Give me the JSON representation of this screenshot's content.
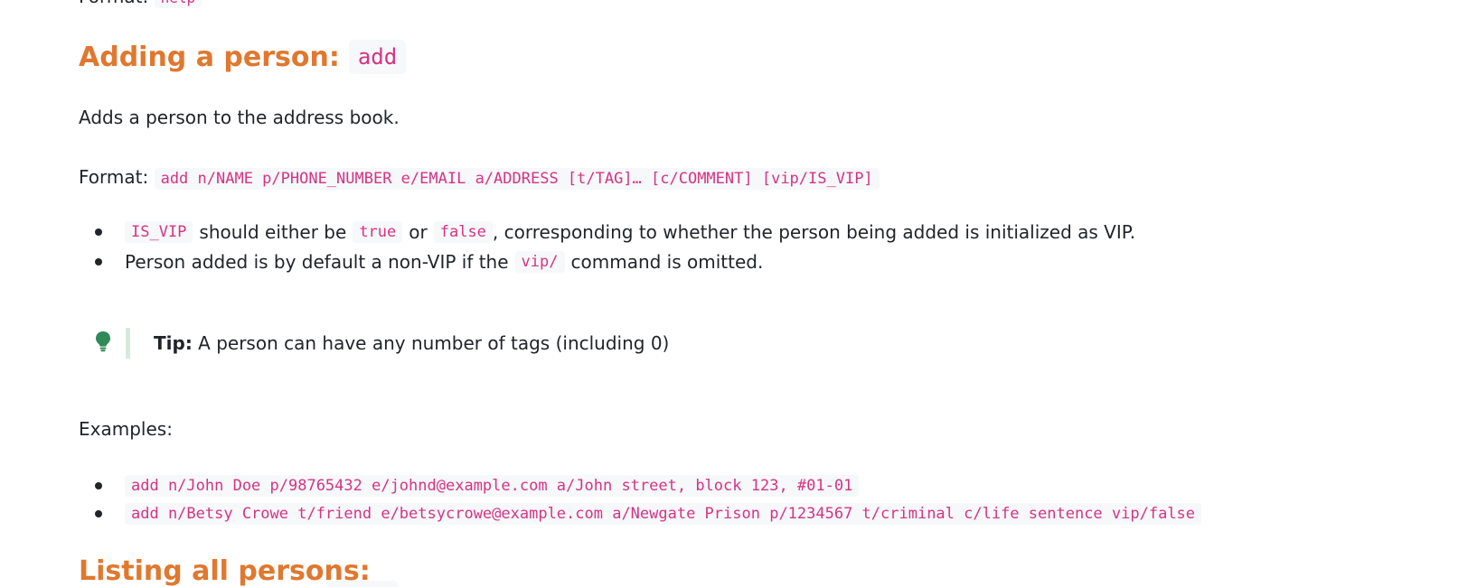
{
  "previous_section": {
    "format_label": "Format:",
    "format_code": "help"
  },
  "section": {
    "heading_text": "Adding a person:",
    "heading_code": "add",
    "description": "Adds a person to the address book.",
    "format_label": "Format:",
    "format_code": "add n/NAME p/PHONE_NUMBER e/EMAIL a/ADDRESS [t/TAG]… [c/COMMENT] [vip/IS_VIP]",
    "notes": [
      {
        "code1": "IS_VIP",
        "text1": "should either be",
        "code2": "true",
        "text2": "or",
        "code3": "false",
        "text3": ", corresponding to whether the person being added is initialized as VIP."
      },
      {
        "text1": "Person added is by default a non-VIP if the",
        "code1": "vip/",
        "text2": "command is omitted."
      }
    ],
    "tip": {
      "icon": "lightbulb-icon",
      "label": "Tip:",
      "text": "A person can have any number of tags (including 0)"
    },
    "examples_label": "Examples:",
    "examples": [
      "add n/John Doe p/98765432 e/johnd@example.com a/John street, block 123, #01-01",
      "add n/Betsy Crowe t/friend e/betsycrowe@example.com a/Newgate Prison p/1234567 t/criminal c/life sentence vip/false"
    ]
  },
  "next_section": {
    "heading_text": "Listing all persons:"
  },
  "colors": {
    "heading": "#e0782f",
    "code_text": "#d63384",
    "code_bg": "#f6f8fa",
    "tip_icon": "#2e8b57",
    "tip_bar": "#d6e9dc"
  }
}
